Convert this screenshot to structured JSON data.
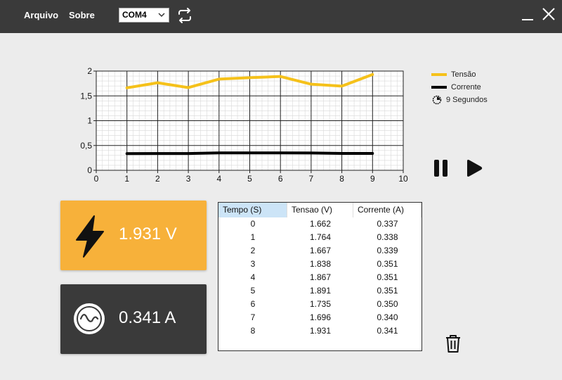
{
  "menu": {
    "file": "Arquivo",
    "about": "Sobre"
  },
  "port": {
    "selected": "COM4"
  },
  "chart_data": {
    "type": "line",
    "x": [
      1,
      2,
      3,
      4,
      5,
      6,
      7,
      8,
      9
    ],
    "series": [
      {
        "name": "Tensão",
        "color": "#f5c11a",
        "values": [
          1.662,
          1.764,
          1.667,
          1.838,
          1.867,
          1.891,
          1.735,
          1.696,
          1.931
        ]
      },
      {
        "name": "Corrente",
        "color": "#000000",
        "values": [
          0.337,
          0.338,
          0.339,
          0.351,
          0.351,
          0.351,
          0.35,
          0.34,
          0.341
        ]
      }
    ],
    "xlim": [
      0,
      10
    ],
    "ylim": [
      0,
      2
    ],
    "xticks": [
      "0",
      "1",
      "2",
      "3",
      "4",
      "5",
      "6",
      "7",
      "8",
      "9",
      "10"
    ],
    "yticks": [
      "0",
      "0,5",
      "1",
      "1,5",
      "2"
    ],
    "grid": true,
    "legend": "right"
  },
  "legend": {
    "voltage": "Tensão",
    "current": "Corrente",
    "interval": "9 Segundos"
  },
  "voltage_card": {
    "value": "1.931 V"
  },
  "current_card": {
    "value": "0.341 A"
  },
  "table": {
    "headers": [
      "Tempo (S)",
      "Tensao (V)",
      "Corrente (A)"
    ],
    "rows": [
      [
        "0",
        "1.662",
        "0.337"
      ],
      [
        "1",
        "1.764",
        "0.338"
      ],
      [
        "2",
        "1.667",
        "0.339"
      ],
      [
        "3",
        "1.838",
        "0.351"
      ],
      [
        "4",
        "1.867",
        "0.351"
      ],
      [
        "5",
        "1.891",
        "0.351"
      ],
      [
        "6",
        "1.735",
        "0.350"
      ],
      [
        "7",
        "1.696",
        "0.340"
      ],
      [
        "8",
        "1.931",
        "0.341"
      ]
    ]
  }
}
